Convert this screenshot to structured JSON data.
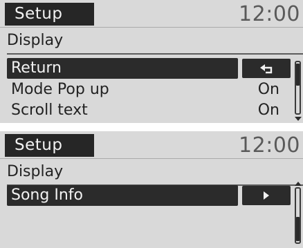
{
  "screens": [
    {
      "title": "Setup",
      "clock": "12:00",
      "section": "Display",
      "rows": [
        {
          "label": "Return",
          "value": "",
          "selected": true,
          "action_icon": "return-arrow-icon"
        },
        {
          "label": "Mode Pop up",
          "value": "On",
          "selected": false
        },
        {
          "label": "Scroll text",
          "value": "On",
          "selected": false
        }
      ],
      "scroll": {
        "position": "top",
        "has_down_arrow": true
      }
    },
    {
      "title": "Setup",
      "clock": "12:00",
      "section": "Display",
      "rows": [
        {
          "label": "Song Info",
          "value": "",
          "selected": true,
          "action_icon": "play-right-icon"
        }
      ],
      "scroll": {
        "position": "bottom",
        "has_up_arrow": true
      }
    }
  ],
  "colors": {
    "screen_bg": "#d9d9d9",
    "highlight": "#2b2b2b",
    "text_dark": "#222222",
    "text_light": "#f2f2f2",
    "clock": "#5a5a5a"
  }
}
